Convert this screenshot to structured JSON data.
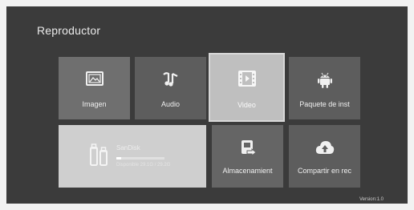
{
  "header": {
    "title": "Reproductor"
  },
  "tiles": {
    "imagen": {
      "label": "Imagen",
      "icon": "image-icon"
    },
    "audio": {
      "label": "Audio",
      "icon": "music-note-icon"
    },
    "video": {
      "label": "Video",
      "icon": "film-icon"
    },
    "paquete": {
      "label": "Paquete de inst",
      "icon": "android-icon"
    },
    "almacenamiento": {
      "label": "Almacenamient",
      "icon": "storage-icon"
    },
    "compartir": {
      "label": "Compartir en rec",
      "icon": "cloud-upload-icon"
    }
  },
  "storage_card": {
    "name": "SanDisk",
    "info": "Disponible 29.1G / 29.2G",
    "used_fraction": 0.1,
    "icon": "usb-drive-icon"
  },
  "footer": {
    "version": "Version:1.0"
  },
  "colors": {
    "background": "#3b3b3b",
    "tile": "#5d5d5d",
    "tile_focused": "#bfbfbf",
    "storage_tile": "#cfcfcf"
  }
}
